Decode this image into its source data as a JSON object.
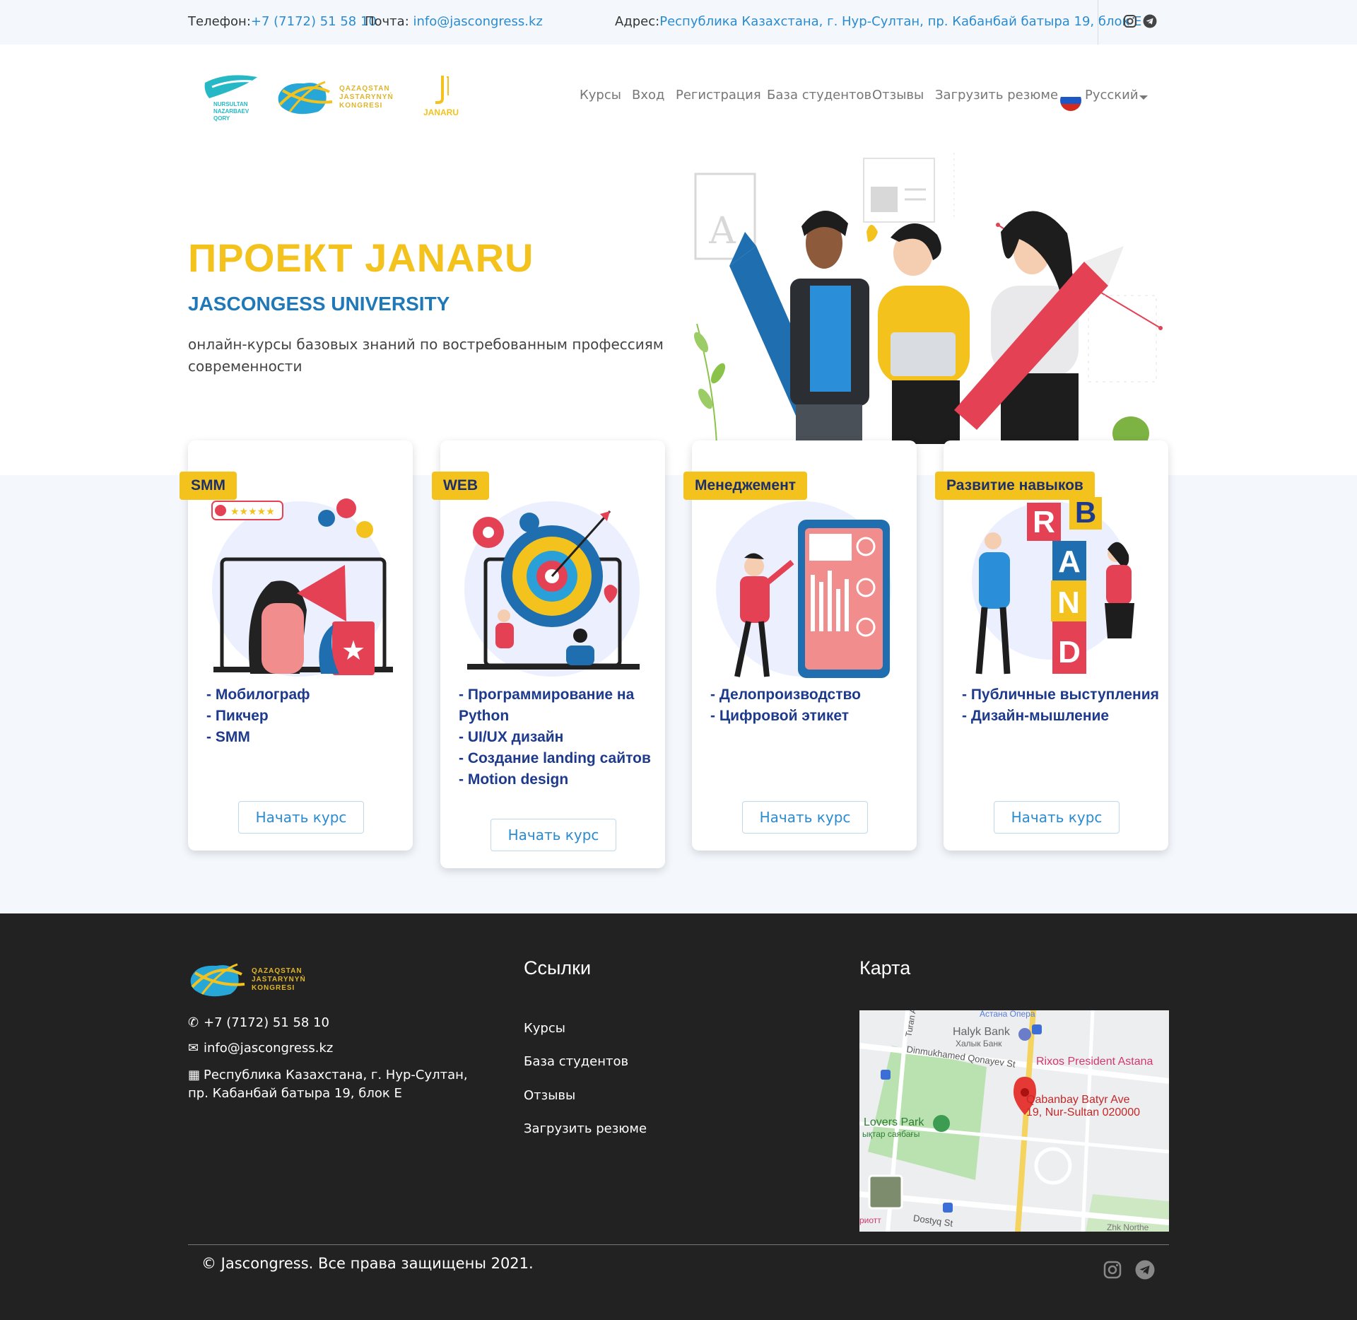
{
  "topbar": {
    "phone_label": "Телефон:",
    "phone": "+7 (7172) 51 58 10",
    "email_label": "Почта:",
    "email": "info@jascongress.kz",
    "address_label": "Адрес:",
    "address": "Республика Казахстана, г. Нур-Султан, пр. Кабанбай батыра 19, блок Е",
    "icons": [
      "instagram-icon",
      "telegram-icon"
    ]
  },
  "logos": {
    "nazarbaev_lines": [
      "NURSULTAN",
      "NAZARBAEV",
      "QORY"
    ],
    "congress_lines": [
      "QAZAQSTAN",
      "JASTARYNYŃ",
      "KONGRESI"
    ],
    "janaru": "JANARU"
  },
  "nav": {
    "items": [
      "Курсы",
      "Вход",
      "Регистрация",
      "База студентов",
      "Отзывы",
      "Загрузить резюме"
    ],
    "language": "Русский"
  },
  "hero": {
    "title": "ПРОЕКТ JANARU",
    "subtitle": "JASCONGESS UNIVERSITY",
    "description": "онлайн-курсы базовых знаний по востребованным профессиям современности"
  },
  "courses": [
    {
      "badge": "SMM",
      "items": [
        "- Мобилограф",
        "- Пикчер",
        "- SMM"
      ],
      "button": "Начать курс"
    },
    {
      "badge": "WEB",
      "items": [
        "- Программирование на Python",
        "- UI/UX дизайн",
        "- Создание landing сайтов",
        "- Motion design"
      ],
      "button": "Начать курс"
    },
    {
      "badge": "Менеджемент",
      "items": [
        "- Делопроизводство",
        "- Цифровой этикет"
      ],
      "button": "Начать курс"
    },
    {
      "badge": "Развитие навыков",
      "items": [
        "- Публичные выступления",
        "- Дизайн-мышление"
      ],
      "button": "Начать курс"
    }
  ],
  "brand_letters": [
    "B",
    "R",
    "A",
    "N",
    "D"
  ],
  "footer": {
    "phone": "+7 (7172) 51 58 10",
    "email": "info@jascongress.kz",
    "address": "Республика Казахстана, г. Нур-Султан, пр. Кабанбай батыра 19, блок Е",
    "links_title": "Ссылки",
    "links": [
      "Курсы",
      "База студентов",
      "Отзывы",
      "Загрузить резюме"
    ],
    "map_title": "Карта",
    "copyright": "© Jascongress. Все права защищены 2021."
  },
  "map": {
    "labels": [
      "Астана Опера",
      "Halyk Bank",
      "Халык Банк",
      "Rixos President Astana",
      "Dinmukhamed Qonayev St",
      "Turan A",
      "Qabanbay Batyr Ave",
      "19, Nur-Sultan 020000",
      "Lovers Park",
      "ықтар саябағы",
      "Dostyq St",
      "риотт",
      "Zhk Northe"
    ]
  },
  "colors": {
    "accent_yellow": "#f4c21d",
    "link_blue": "#2a8bd0",
    "title_blue": "#1f78b8",
    "dark_navy": "#1d3a8c",
    "footer_bg": "#222222",
    "section_bg": "#f4f8fd"
  }
}
